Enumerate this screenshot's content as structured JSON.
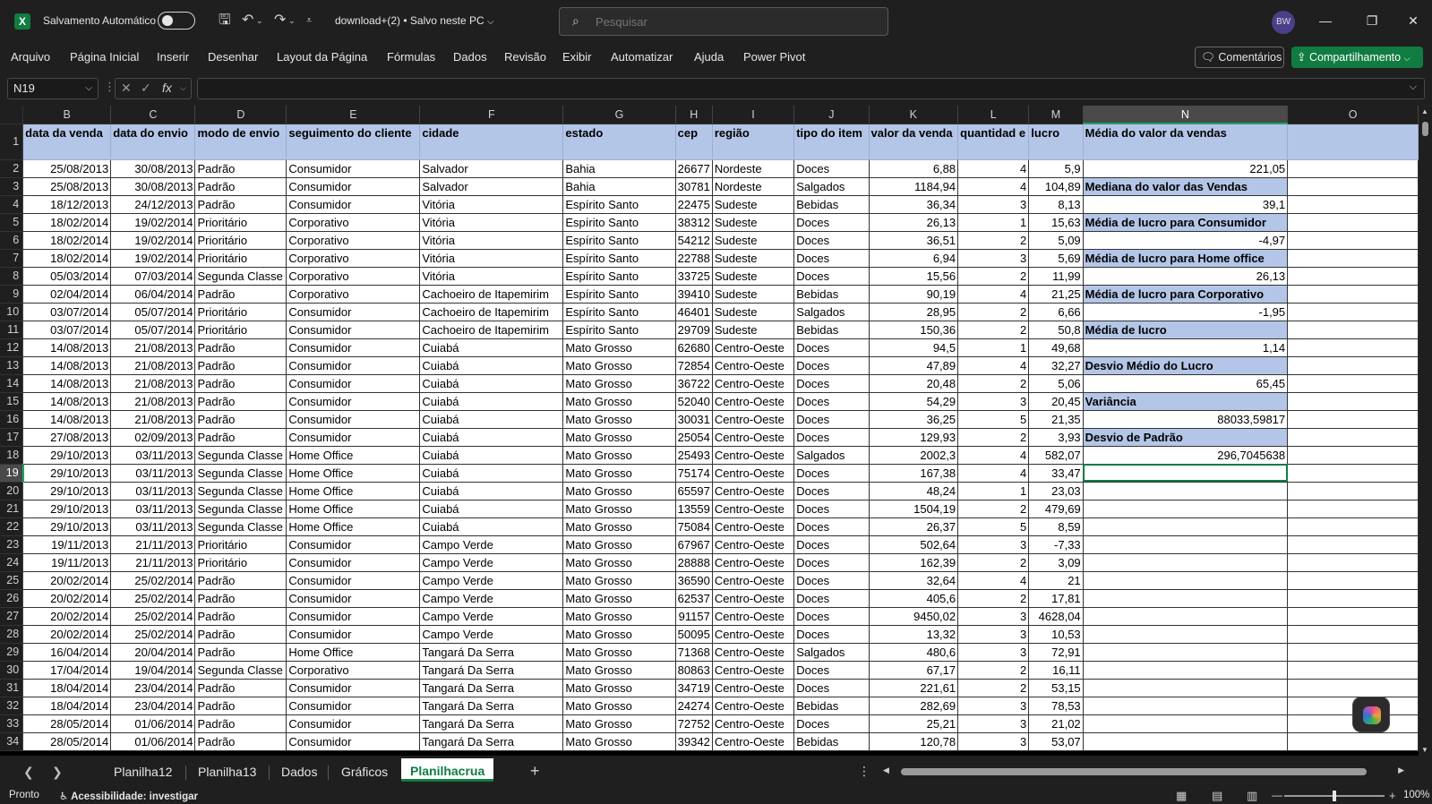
{
  "titlebar": {
    "autosave_label": "Salvamento Automático",
    "doc_title": "download+(2) • Salvo neste PC",
    "search_placeholder": "Pesquisar",
    "avatar_initials": "BW"
  },
  "menu": {
    "items": [
      "Arquivo",
      "Página Inicial",
      "Inserir",
      "Desenhar",
      "Layout da Página",
      "Fórmulas",
      "Dados",
      "Revisão",
      "Exibir",
      "Automatizar",
      "Ajuda",
      "Power Pivot"
    ],
    "comments_label": "Comentários",
    "share_label": "Compartilhamento"
  },
  "formula": {
    "namebox": "N19",
    "fx": "fx",
    "value": ""
  },
  "sheet": {
    "col_letters": [
      "B",
      "C",
      "D",
      "E",
      "F",
      "G",
      "H",
      "I",
      "J",
      "K",
      "L",
      "M",
      "N",
      "O"
    ],
    "header_row": [
      "data da venda",
      "data do envio",
      "modo de envio",
      "seguimento do cliente",
      "cidade",
      "estado",
      "cep",
      "região",
      "tipo do item",
      "valor da venda",
      "quantidad e",
      "lucro"
    ],
    "rows": [
      [
        "25/08/2013",
        "30/08/2013",
        "Padrão",
        "Consumidor",
        "Salvador",
        "Bahia",
        "26677",
        "Nordeste",
        "Doces",
        "6,88",
        "4",
        "5,9"
      ],
      [
        "25/08/2013",
        "30/08/2013",
        "Padrão",
        "Consumidor",
        "Salvador",
        "Bahia",
        "30781",
        "Nordeste",
        "Salgados",
        "1184,94",
        "4",
        "104,89"
      ],
      [
        "18/12/2013",
        "24/12/2013",
        "Padrão",
        "Consumidor",
        "Vitória",
        "Espírito Santo",
        "22475",
        "Sudeste",
        "Bebidas",
        "36,34",
        "3",
        "8,13"
      ],
      [
        "18/02/2014",
        "19/02/2014",
        "Prioritário",
        "Corporativo",
        "Vitória",
        "Espírito Santo",
        "38312",
        "Sudeste",
        "Doces",
        "26,13",
        "1",
        "15,63"
      ],
      [
        "18/02/2014",
        "19/02/2014",
        "Prioritário",
        "Corporativo",
        "Vitória",
        "Espírito Santo",
        "54212",
        "Sudeste",
        "Doces",
        "36,51",
        "2",
        "5,09"
      ],
      [
        "18/02/2014",
        "19/02/2014",
        "Prioritário",
        "Corporativo",
        "Vitória",
        "Espírito Santo",
        "22788",
        "Sudeste",
        "Doces",
        "6,94",
        "3",
        "5,69"
      ],
      [
        "05/03/2014",
        "07/03/2014",
        "Segunda Classe",
        "Corporativo",
        "Vitória",
        "Espírito Santo",
        "33725",
        "Sudeste",
        "Doces",
        "15,56",
        "2",
        "11,99"
      ],
      [
        "02/04/2014",
        "06/04/2014",
        "Padrão",
        "Corporativo",
        "Cachoeiro de Itapemirim",
        "Espírito Santo",
        "39410",
        "Sudeste",
        "Bebidas",
        "90,19",
        "4",
        "21,25"
      ],
      [
        "03/07/2014",
        "05/07/2014",
        "Prioritário",
        "Consumidor",
        "Cachoeiro de Itapemirim",
        "Espírito Santo",
        "46401",
        "Sudeste",
        "Salgados",
        "28,95",
        "2",
        "6,66"
      ],
      [
        "03/07/2014",
        "05/07/2014",
        "Prioritário",
        "Consumidor",
        "Cachoeiro de Itapemirim",
        "Espírito Santo",
        "29709",
        "Sudeste",
        "Bebidas",
        "150,36",
        "2",
        "50,8"
      ],
      [
        "14/08/2013",
        "21/08/2013",
        "Padrão",
        "Consumidor",
        "Cuiabá",
        "Mato Grosso",
        "62680",
        "Centro-Oeste",
        "Doces",
        "94,5",
        "1",
        "49,68"
      ],
      [
        "14/08/2013",
        "21/08/2013",
        "Padrão",
        "Consumidor",
        "Cuiabá",
        "Mato Grosso",
        "72854",
        "Centro-Oeste",
        "Doces",
        "47,89",
        "4",
        "32,27"
      ],
      [
        "14/08/2013",
        "21/08/2013",
        "Padrão",
        "Consumidor",
        "Cuiabá",
        "Mato Grosso",
        "36722",
        "Centro-Oeste",
        "Doces",
        "20,48",
        "2",
        "5,06"
      ],
      [
        "14/08/2013",
        "21/08/2013",
        "Padrão",
        "Consumidor",
        "Cuiabá",
        "Mato Grosso",
        "52040",
        "Centro-Oeste",
        "Doces",
        "54,29",
        "3",
        "20,45"
      ],
      [
        "14/08/2013",
        "21/08/2013",
        "Padrão",
        "Consumidor",
        "Cuiabá",
        "Mato Grosso",
        "30031",
        "Centro-Oeste",
        "Doces",
        "36,25",
        "5",
        "21,35"
      ],
      [
        "27/08/2013",
        "02/09/2013",
        "Padrão",
        "Consumidor",
        "Cuiabá",
        "Mato Grosso",
        "25054",
        "Centro-Oeste",
        "Doces",
        "129,93",
        "2",
        "3,93"
      ],
      [
        "29/10/2013",
        "03/11/2013",
        "Segunda Classe",
        "Home Office",
        "Cuiabá",
        "Mato Grosso",
        "25493",
        "Centro-Oeste",
        "Salgados",
        "2002,3",
        "4",
        "582,07"
      ],
      [
        "29/10/2013",
        "03/11/2013",
        "Segunda Classe",
        "Home Office",
        "Cuiabá",
        "Mato Grosso",
        "75174",
        "Centro-Oeste",
        "Doces",
        "167,38",
        "4",
        "33,47"
      ],
      [
        "29/10/2013",
        "03/11/2013",
        "Segunda Classe",
        "Home Office",
        "Cuiabá",
        "Mato Grosso",
        "65597",
        "Centro-Oeste",
        "Doces",
        "48,24",
        "1",
        "23,03"
      ],
      [
        "29/10/2013",
        "03/11/2013",
        "Segunda Classe",
        "Home Office",
        "Cuiabá",
        "Mato Grosso",
        "13559",
        "Centro-Oeste",
        "Doces",
        "1504,19",
        "2",
        "479,69"
      ],
      [
        "29/10/2013",
        "03/11/2013",
        "Segunda Classe",
        "Home Office",
        "Cuiabá",
        "Mato Grosso",
        "75084",
        "Centro-Oeste",
        "Doces",
        "26,37",
        "5",
        "8,59"
      ],
      [
        "19/11/2013",
        "21/11/2013",
        "Prioritário",
        "Consumidor",
        "Campo Verde",
        "Mato Grosso",
        "67967",
        "Centro-Oeste",
        "Doces",
        "502,64",
        "3",
        "-7,33"
      ],
      [
        "19/11/2013",
        "21/11/2013",
        "Prioritário",
        "Consumidor",
        "Campo Verde",
        "Mato Grosso",
        "28888",
        "Centro-Oeste",
        "Doces",
        "162,39",
        "2",
        "3,09"
      ],
      [
        "20/02/2014",
        "25/02/2014",
        "Padrão",
        "Consumidor",
        "Campo Verde",
        "Mato Grosso",
        "36590",
        "Centro-Oeste",
        "Doces",
        "32,64",
        "4",
        "21"
      ],
      [
        "20/02/2014",
        "25/02/2014",
        "Padrão",
        "Consumidor",
        "Campo Verde",
        "Mato Grosso",
        "62537",
        "Centro-Oeste",
        "Doces",
        "405,6",
        "2",
        "17,81"
      ],
      [
        "20/02/2014",
        "25/02/2014",
        "Padrão",
        "Consumidor",
        "Campo Verde",
        "Mato Grosso",
        "91157",
        "Centro-Oeste",
        "Doces",
        "9450,02",
        "3",
        "4628,04"
      ],
      [
        "20/02/2014",
        "25/02/2014",
        "Padrão",
        "Consumidor",
        "Campo Verde",
        "Mato Grosso",
        "50095",
        "Centro-Oeste",
        "Doces",
        "13,32",
        "3",
        "10,53"
      ],
      [
        "16/04/2014",
        "20/04/2014",
        "Padrão",
        "Home Office",
        "Tangará Da Serra",
        "Mato Grosso",
        "71368",
        "Centro-Oeste",
        "Salgados",
        "480,6",
        "3",
        "72,91"
      ],
      [
        "17/04/2014",
        "19/04/2014",
        "Segunda Classe",
        "Corporativo",
        "Tangará Da Serra",
        "Mato Grosso",
        "80863",
        "Centro-Oeste",
        "Doces",
        "67,17",
        "2",
        "16,11"
      ],
      [
        "18/04/2014",
        "23/04/2014",
        "Padrão",
        "Consumidor",
        "Tangará Da Serra",
        "Mato Grosso",
        "34719",
        "Centro-Oeste",
        "Doces",
        "221,61",
        "2",
        "53,15"
      ],
      [
        "18/04/2014",
        "23/04/2014",
        "Padrão",
        "Consumidor",
        "Tangará Da Serra",
        "Mato Grosso",
        "24274",
        "Centro-Oeste",
        "Bebidas",
        "282,69",
        "3",
        "78,53"
      ],
      [
        "28/05/2014",
        "01/06/2014",
        "Padrão",
        "Consumidor",
        "Tangará Da Serra",
        "Mato Grosso",
        "72752",
        "Centro-Oeste",
        "Doces",
        "25,21",
        "3",
        "21,02"
      ],
      [
        "28/05/2014",
        "01/06/2014",
        "Padrão",
        "Consumidor",
        "Tangará Da Serra",
        "Mato Grosso",
        "39342",
        "Centro-Oeste",
        "Bebidas",
        "120,78",
        "3",
        "53,07"
      ]
    ],
    "n_column": [
      {
        "row": 1,
        "text": "Média do  valor  da vendas",
        "kind": "label"
      },
      {
        "row": 2,
        "text": "221,05",
        "kind": "value"
      },
      {
        "row": 3,
        "text": "Mediana do  valor  das  Vendas",
        "kind": "label"
      },
      {
        "row": 4,
        "text": "39,1",
        "kind": "value"
      },
      {
        "row": 5,
        "text": "Média  de  lucro para Consumidor",
        "kind": "label"
      },
      {
        "row": 6,
        "text": "-4,97",
        "kind": "value"
      },
      {
        "row": 7,
        "text": "Média  de  lucro para Home office",
        "kind": "label"
      },
      {
        "row": 8,
        "text": "26,13",
        "kind": "value"
      },
      {
        "row": 9,
        "text": "Média  de lucro  para  Corporativo",
        "kind": "label"
      },
      {
        "row": 10,
        "text": "-1,95",
        "kind": "value"
      },
      {
        "row": 11,
        "text": "Média de  lucro",
        "kind": "label"
      },
      {
        "row": 12,
        "text": "1,14",
        "kind": "value"
      },
      {
        "row": 13,
        "text": "Desvio Médio do  Lucro",
        "kind": "label"
      },
      {
        "row": 14,
        "text": "65,45",
        "kind": "value"
      },
      {
        "row": 15,
        "text": "Variância",
        "kind": "label"
      },
      {
        "row": 16,
        "text": "88033,59817",
        "kind": "value"
      },
      {
        "row": 17,
        "text": "Desvio de Padrão",
        "kind": "label"
      },
      {
        "row": 18,
        "text": "296,7045638",
        "kind": "value"
      }
    ],
    "selected_row": 19,
    "selected_col": "N"
  },
  "tabs": {
    "items": [
      "Planilha12",
      "Planilha13",
      "Dados",
      "Gráficos",
      "Planilhacrua"
    ],
    "active": "Planilhacrua"
  },
  "status": {
    "ready": "Pronto",
    "accessibility": "Acessibilidade: investigar",
    "zoom": "100%"
  },
  "colors": {
    "header_fill": "#b4c6e7",
    "accent": "#107c41"
  }
}
